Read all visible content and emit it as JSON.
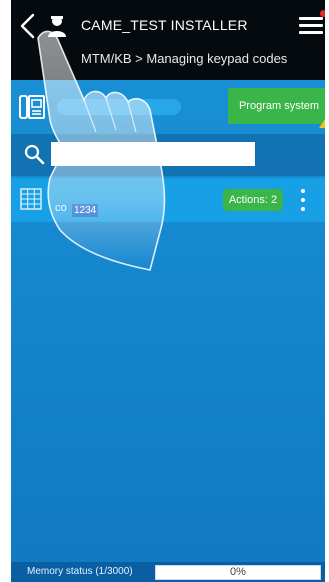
{
  "header": {
    "title": "CAME_TEST INSTALLER",
    "breadcrumb": "MTM/KB > Managing keypad codes",
    "back_icon": "back-arrow-icon",
    "user_icon": "installer-user-icon",
    "menu_icon": "hamburger-menu-icon",
    "notification_color": "#e8292a"
  },
  "toolbar": {
    "device_icon": "intercom-icon",
    "program_button": "Program system",
    "warning_icon": "warning-triangle-icon"
  },
  "search": {
    "icon": "search-icon",
    "value": ""
  },
  "codes": [
    {
      "icon": "keypad-icon",
      "prefix": "co",
      "code": "1234",
      "actions_label": "Actions: 2",
      "more_icon": "kebab-menu-icon"
    }
  ],
  "footer": {
    "memory_label": "Memory status (1/3000)",
    "memory_percent_text": "0%",
    "memory_fraction": 0.0003
  },
  "colors": {
    "accent_green": "#39b54a",
    "header_bg": "#050a0e",
    "screen_blue": "#1587cf"
  }
}
